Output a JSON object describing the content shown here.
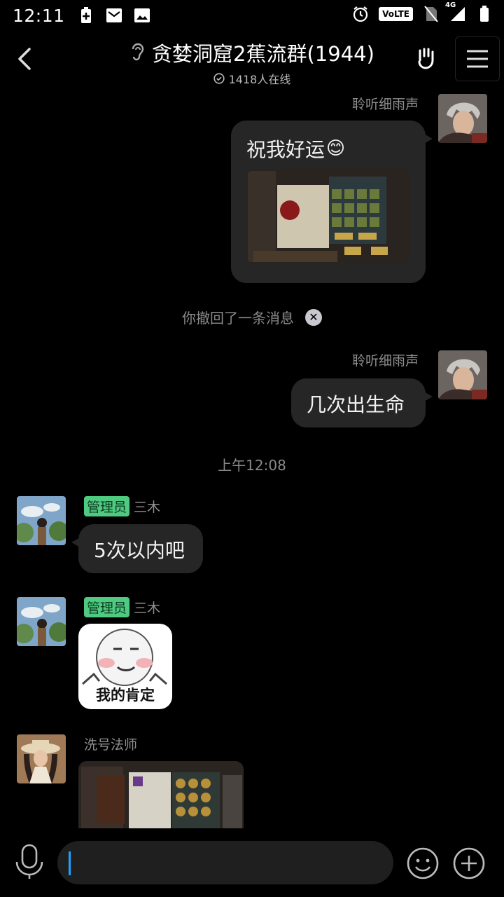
{
  "status_bar": {
    "time": "12:11",
    "left_icons": [
      "battery-saver-icon",
      "mail-icon",
      "image-icon"
    ],
    "right_icons": [
      "alarm-icon",
      "volte-badge",
      "no-sim-icon",
      "signal-4g-icon",
      "battery-icon"
    ],
    "volte_label": "VoLTE",
    "network_label": "4G"
  },
  "header": {
    "title": "贪婪洞窟2蕉流群(1944)",
    "online_text": "1418人在线",
    "icons": {
      "back": "chevron-left-icon",
      "ear": "ear-icon",
      "hand": "hand-rock-icon",
      "menu": "hamburger-menu-icon"
    }
  },
  "messages": [
    {
      "side": "right",
      "sender": "聆听细雨声",
      "text": "祝我好运",
      "emoji": "😊",
      "has_image": true
    },
    {
      "type": "system",
      "text": "你撤回了一条消息"
    },
    {
      "side": "right",
      "sender": "聆听细雨声",
      "text": "几次出生命"
    },
    {
      "type": "time",
      "text": "上午12:08"
    },
    {
      "side": "left",
      "badge": "管理员",
      "sender": "三木",
      "text": "5次以内吧"
    },
    {
      "side": "left",
      "badge": "管理员",
      "sender": "三木",
      "sticker_caption": "我的肯定"
    },
    {
      "side": "left",
      "sender": "洗号法师",
      "has_image": true
    }
  ],
  "input_bar": {
    "placeholder": "",
    "value": ""
  },
  "colors": {
    "background": "#000000",
    "bubble": "#262626",
    "admin_badge": "#4ecb80",
    "caret": "#1ea3ff"
  }
}
